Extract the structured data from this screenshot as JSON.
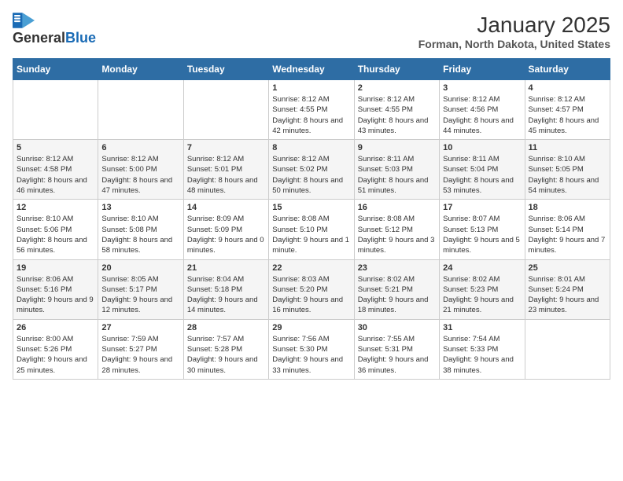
{
  "header": {
    "logo_line1": "General",
    "logo_line2": "Blue",
    "title": "January 2025",
    "subtitle": "Forman, North Dakota, United States"
  },
  "weekdays": [
    "Sunday",
    "Monday",
    "Tuesday",
    "Wednesday",
    "Thursday",
    "Friday",
    "Saturday"
  ],
  "weeks": [
    [
      {
        "day": "",
        "info": ""
      },
      {
        "day": "",
        "info": ""
      },
      {
        "day": "",
        "info": ""
      },
      {
        "day": "1",
        "info": "Sunrise: 8:12 AM\nSunset: 4:55 PM\nDaylight: 8 hours and 42 minutes."
      },
      {
        "day": "2",
        "info": "Sunrise: 8:12 AM\nSunset: 4:55 PM\nDaylight: 8 hours and 43 minutes."
      },
      {
        "day": "3",
        "info": "Sunrise: 8:12 AM\nSunset: 4:56 PM\nDaylight: 8 hours and 44 minutes."
      },
      {
        "day": "4",
        "info": "Sunrise: 8:12 AM\nSunset: 4:57 PM\nDaylight: 8 hours and 45 minutes."
      }
    ],
    [
      {
        "day": "5",
        "info": "Sunrise: 8:12 AM\nSunset: 4:58 PM\nDaylight: 8 hours and 46 minutes."
      },
      {
        "day": "6",
        "info": "Sunrise: 8:12 AM\nSunset: 5:00 PM\nDaylight: 8 hours and 47 minutes."
      },
      {
        "day": "7",
        "info": "Sunrise: 8:12 AM\nSunset: 5:01 PM\nDaylight: 8 hours and 48 minutes."
      },
      {
        "day": "8",
        "info": "Sunrise: 8:12 AM\nSunset: 5:02 PM\nDaylight: 8 hours and 50 minutes."
      },
      {
        "day": "9",
        "info": "Sunrise: 8:11 AM\nSunset: 5:03 PM\nDaylight: 8 hours and 51 minutes."
      },
      {
        "day": "10",
        "info": "Sunrise: 8:11 AM\nSunset: 5:04 PM\nDaylight: 8 hours and 53 minutes."
      },
      {
        "day": "11",
        "info": "Sunrise: 8:10 AM\nSunset: 5:05 PM\nDaylight: 8 hours and 54 minutes."
      }
    ],
    [
      {
        "day": "12",
        "info": "Sunrise: 8:10 AM\nSunset: 5:06 PM\nDaylight: 8 hours and 56 minutes."
      },
      {
        "day": "13",
        "info": "Sunrise: 8:10 AM\nSunset: 5:08 PM\nDaylight: 8 hours and 58 minutes."
      },
      {
        "day": "14",
        "info": "Sunrise: 8:09 AM\nSunset: 5:09 PM\nDaylight: 9 hours and 0 minutes."
      },
      {
        "day": "15",
        "info": "Sunrise: 8:08 AM\nSunset: 5:10 PM\nDaylight: 9 hours and 1 minute."
      },
      {
        "day": "16",
        "info": "Sunrise: 8:08 AM\nSunset: 5:12 PM\nDaylight: 9 hours and 3 minutes."
      },
      {
        "day": "17",
        "info": "Sunrise: 8:07 AM\nSunset: 5:13 PM\nDaylight: 9 hours and 5 minutes."
      },
      {
        "day": "18",
        "info": "Sunrise: 8:06 AM\nSunset: 5:14 PM\nDaylight: 9 hours and 7 minutes."
      }
    ],
    [
      {
        "day": "19",
        "info": "Sunrise: 8:06 AM\nSunset: 5:16 PM\nDaylight: 9 hours and 9 minutes."
      },
      {
        "day": "20",
        "info": "Sunrise: 8:05 AM\nSunset: 5:17 PM\nDaylight: 9 hours and 12 minutes."
      },
      {
        "day": "21",
        "info": "Sunrise: 8:04 AM\nSunset: 5:18 PM\nDaylight: 9 hours and 14 minutes."
      },
      {
        "day": "22",
        "info": "Sunrise: 8:03 AM\nSunset: 5:20 PM\nDaylight: 9 hours and 16 minutes."
      },
      {
        "day": "23",
        "info": "Sunrise: 8:02 AM\nSunset: 5:21 PM\nDaylight: 9 hours and 18 minutes."
      },
      {
        "day": "24",
        "info": "Sunrise: 8:02 AM\nSunset: 5:23 PM\nDaylight: 9 hours and 21 minutes."
      },
      {
        "day": "25",
        "info": "Sunrise: 8:01 AM\nSunset: 5:24 PM\nDaylight: 9 hours and 23 minutes."
      }
    ],
    [
      {
        "day": "26",
        "info": "Sunrise: 8:00 AM\nSunset: 5:26 PM\nDaylight: 9 hours and 25 minutes."
      },
      {
        "day": "27",
        "info": "Sunrise: 7:59 AM\nSunset: 5:27 PM\nDaylight: 9 hours and 28 minutes."
      },
      {
        "day": "28",
        "info": "Sunrise: 7:57 AM\nSunset: 5:28 PM\nDaylight: 9 hours and 30 minutes."
      },
      {
        "day": "29",
        "info": "Sunrise: 7:56 AM\nSunset: 5:30 PM\nDaylight: 9 hours and 33 minutes."
      },
      {
        "day": "30",
        "info": "Sunrise: 7:55 AM\nSunset: 5:31 PM\nDaylight: 9 hours and 36 minutes."
      },
      {
        "day": "31",
        "info": "Sunrise: 7:54 AM\nSunset: 5:33 PM\nDaylight: 9 hours and 38 minutes."
      },
      {
        "day": "",
        "info": ""
      }
    ]
  ]
}
